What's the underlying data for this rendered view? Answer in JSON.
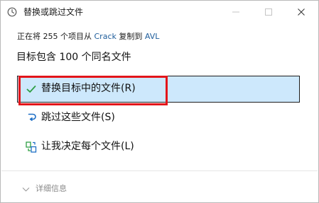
{
  "window": {
    "title": "替换或跳过文件",
    "icon": "clock-icon",
    "controls": [
      "minimize-icon",
      "maximize-icon",
      "close-icon"
    ]
  },
  "info": {
    "prefix": "正在将 255 个项目从 ",
    "source": "Crack",
    "middle": " 复制到 ",
    "destination": "AVL"
  },
  "heading": "目标包含 100 个同名文件",
  "options": [
    {
      "label": "替换目标中的文件(R)",
      "icon": "checkmark-icon",
      "selected": true
    },
    {
      "label": "跳过这些文件(S)",
      "icon": "undo-arrow-icon",
      "selected": false
    },
    {
      "label": "让我决定每个文件(L)",
      "icon": "compare-files-icon",
      "selected": false
    }
  ],
  "details": {
    "label": "详细信息",
    "icon": "chevron-down-icon"
  },
  "colors": {
    "selected_bg": "#cde8fc",
    "link": "#1e5d9b",
    "highlight": "#e3151a",
    "check": "#2e9e44"
  }
}
